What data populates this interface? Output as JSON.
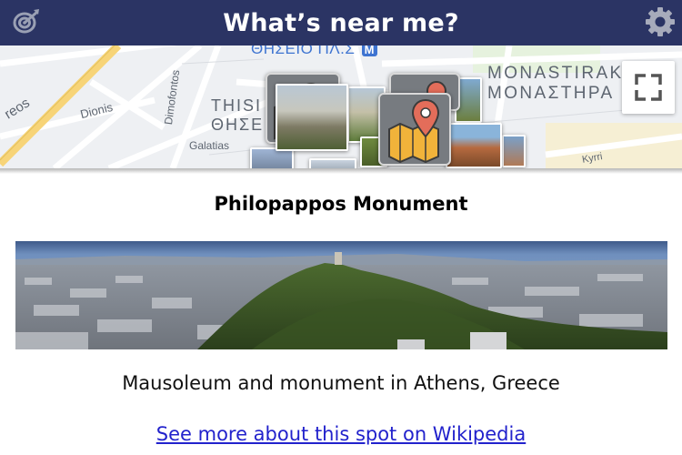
{
  "header": {
    "title": "What’s near me?",
    "left_icon": "target-dart-icon",
    "right_icon": "gear-icon",
    "bg_color": "#2b3464"
  },
  "map": {
    "labels": {
      "metro_station": "ΘΗΣΕΙΟ ΠΛ.Σ",
      "metro_badge": "M",
      "monastiraki_latin": "ΜΟΝΑSTIRAK",
      "monastiraki_greek": "ΜΟΝΑΣΤΗΡΑ",
      "thisio_latin": "THISI",
      "thisio_greek": "ΘΗΣΕ",
      "street_reos": "reos",
      "street_dionis": "Dionis",
      "street_dimofontos": "Dimofontos",
      "street_galatias": "Galatias",
      "street_kyrr": "Kyrri"
    },
    "fullscreen_icon": "fullscreen-icon",
    "cluster_icon": "map-pin-icon"
  },
  "place": {
    "title": "Philopappos Monument",
    "description": "Mausoleum and monument in Athens, Greece",
    "link_text": "See more about this spot on Wikipedia"
  }
}
